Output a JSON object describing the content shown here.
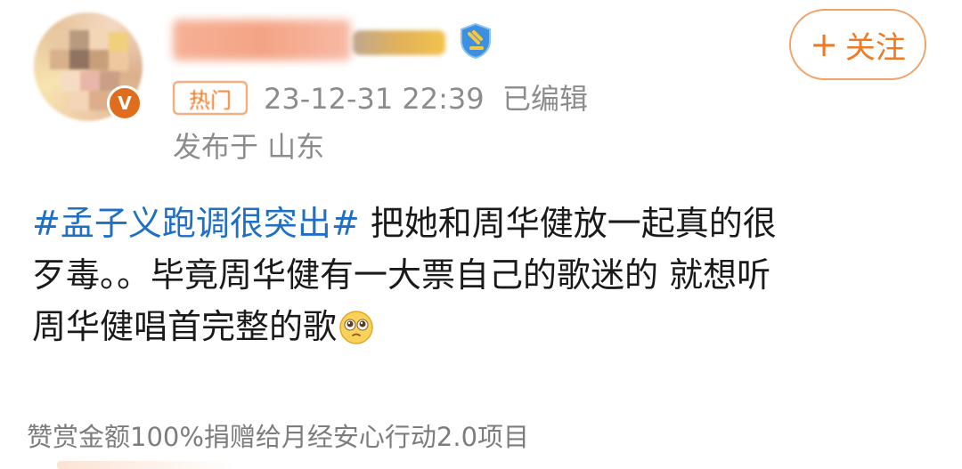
{
  "author": {
    "avatar_badge": "V",
    "username_redacted": true
  },
  "follow_button": {
    "plus": "+",
    "label": "关注"
  },
  "meta": {
    "hot_tag": "热门",
    "timestamp": "23-12-31 22:39",
    "edited": "已编辑",
    "location": "发布于 山东"
  },
  "post": {
    "hashtag": "#孟子义跑调很突出#",
    "text_line1": " 把她和周华健放一起真的很",
    "text_line2": "歹毒。。毕竟周华健有一大票自己的歌迷的 就想听",
    "text_line3": "周华健唱首完整的歌",
    "emoji": "pleading-face-icon"
  },
  "footer": {
    "donation_note": "赞赏金额100%捐赠给月经安心行动2.0项目"
  },
  "colors": {
    "accent_orange": "#f07a23",
    "hashtag_blue": "#1f6fc3",
    "meta_gray": "#8c8c8c"
  }
}
